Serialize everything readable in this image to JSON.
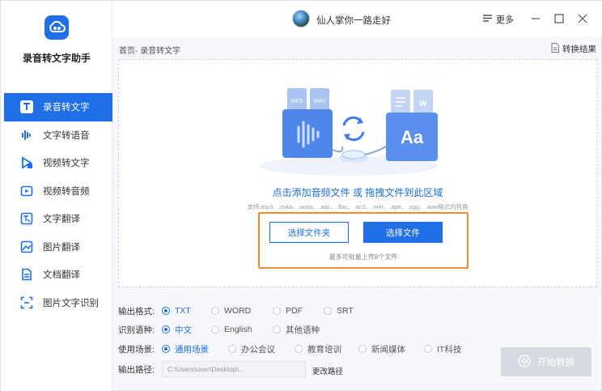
{
  "app": {
    "title": "录音转文字助手",
    "logo_icon": "cloud-link-icon",
    "accent": "#1e6fe8",
    "highlight_color": "#f08a2c"
  },
  "sidebar": {
    "items": [
      {
        "label": "录音转文字",
        "icon": "T-icon",
        "active": true
      },
      {
        "label": "文字转语音",
        "icon": "sound-wave-icon",
        "active": false
      },
      {
        "label": "视频转文字",
        "icon": "video-play-icon",
        "active": false
      },
      {
        "label": "视频转音频",
        "icon": "video-audio-icon",
        "active": false
      },
      {
        "label": "文字翻译",
        "icon": "text-translate-icon",
        "active": false
      },
      {
        "label": "图片翻译",
        "icon": "image-translate-icon",
        "active": false
      },
      {
        "label": "文档翻译",
        "icon": "doc-translate-icon",
        "active": false
      },
      {
        "label": "图片文字识别",
        "icon": "ocr-scan-icon",
        "active": false
      }
    ]
  },
  "titlebar": {
    "user_name": "仙人掌你一路走好",
    "more_label": "更多"
  },
  "breadcrumb": "首页- 录音转文字",
  "result_link": "转换结果",
  "drop": {
    "main_text": "点击添加音频文件 或 拖拽文件到此区域",
    "sub_text": "支持.mp3、.m4a、.wma、.aac、.flac、.ac3、.m4r、.ape、.ogg、.wav格式的转换",
    "folder_button": "选择文件夹",
    "file_button": "选择文件",
    "limit_text": "最多可批量上传8个文件",
    "illustration_labels": {
      "mp3": "MP3",
      "wav": "WAV",
      "word": "W",
      "aa": "Aa"
    }
  },
  "settings": {
    "output_format": {
      "label": "输出格式:",
      "options": [
        "TXT",
        "WORD",
        "PDF",
        "SRT"
      ],
      "selected": "TXT"
    },
    "language": {
      "label": "识别语种:",
      "options": [
        "中文",
        "English",
        "其他语种"
      ],
      "selected": "中文"
    },
    "scene": {
      "label": "使用场景:",
      "options": [
        "通用场景",
        "办公会议",
        "教育培训",
        "新闻媒体",
        "IT科技"
      ],
      "selected": "通用场景"
    },
    "output_path": {
      "label": "输出路径:",
      "value": "C:\\Users\\user\\Desktop\\...",
      "change_label": "更改路径"
    }
  },
  "start_button": "开始转换"
}
